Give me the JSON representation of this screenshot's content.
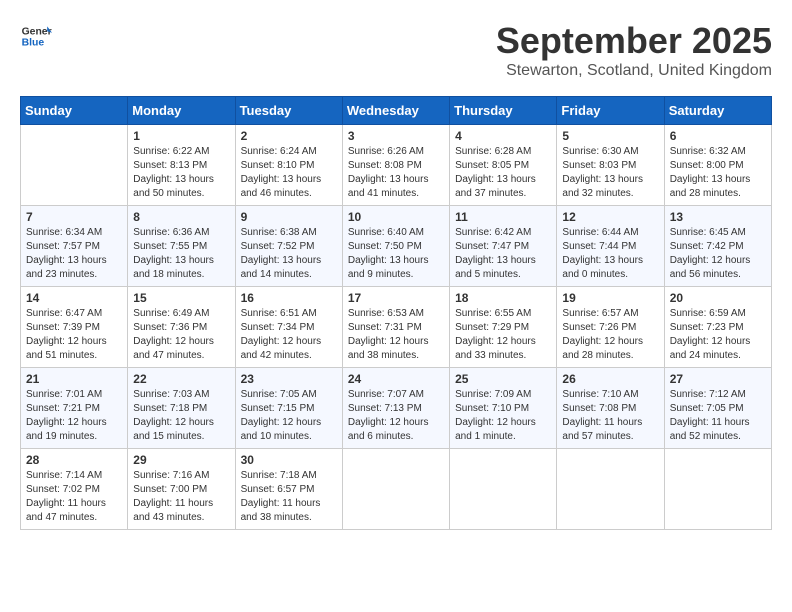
{
  "header": {
    "logo_line1": "General",
    "logo_line2": "Blue",
    "month": "September 2025",
    "location": "Stewarton, Scotland, United Kingdom"
  },
  "weekdays": [
    "Sunday",
    "Monday",
    "Tuesday",
    "Wednesday",
    "Thursday",
    "Friday",
    "Saturday"
  ],
  "weeks": [
    [
      {
        "day": "",
        "sunrise": "",
        "sunset": "",
        "daylight": ""
      },
      {
        "day": "1",
        "sunrise": "Sunrise: 6:22 AM",
        "sunset": "Sunset: 8:13 PM",
        "daylight": "Daylight: 13 hours and 50 minutes."
      },
      {
        "day": "2",
        "sunrise": "Sunrise: 6:24 AM",
        "sunset": "Sunset: 8:10 PM",
        "daylight": "Daylight: 13 hours and 46 minutes."
      },
      {
        "day": "3",
        "sunrise": "Sunrise: 6:26 AM",
        "sunset": "Sunset: 8:08 PM",
        "daylight": "Daylight: 13 hours and 41 minutes."
      },
      {
        "day": "4",
        "sunrise": "Sunrise: 6:28 AM",
        "sunset": "Sunset: 8:05 PM",
        "daylight": "Daylight: 13 hours and 37 minutes."
      },
      {
        "day": "5",
        "sunrise": "Sunrise: 6:30 AM",
        "sunset": "Sunset: 8:03 PM",
        "daylight": "Daylight: 13 hours and 32 minutes."
      },
      {
        "day": "6",
        "sunrise": "Sunrise: 6:32 AM",
        "sunset": "Sunset: 8:00 PM",
        "daylight": "Daylight: 13 hours and 28 minutes."
      }
    ],
    [
      {
        "day": "7",
        "sunrise": "Sunrise: 6:34 AM",
        "sunset": "Sunset: 7:57 PM",
        "daylight": "Daylight: 13 hours and 23 minutes."
      },
      {
        "day": "8",
        "sunrise": "Sunrise: 6:36 AM",
        "sunset": "Sunset: 7:55 PM",
        "daylight": "Daylight: 13 hours and 18 minutes."
      },
      {
        "day": "9",
        "sunrise": "Sunrise: 6:38 AM",
        "sunset": "Sunset: 7:52 PM",
        "daylight": "Daylight: 13 hours and 14 minutes."
      },
      {
        "day": "10",
        "sunrise": "Sunrise: 6:40 AM",
        "sunset": "Sunset: 7:50 PM",
        "daylight": "Daylight: 13 hours and 9 minutes."
      },
      {
        "day": "11",
        "sunrise": "Sunrise: 6:42 AM",
        "sunset": "Sunset: 7:47 PM",
        "daylight": "Daylight: 13 hours and 5 minutes."
      },
      {
        "day": "12",
        "sunrise": "Sunrise: 6:44 AM",
        "sunset": "Sunset: 7:44 PM",
        "daylight": "Daylight: 13 hours and 0 minutes."
      },
      {
        "day": "13",
        "sunrise": "Sunrise: 6:45 AM",
        "sunset": "Sunset: 7:42 PM",
        "daylight": "Daylight: 12 hours and 56 minutes."
      }
    ],
    [
      {
        "day": "14",
        "sunrise": "Sunrise: 6:47 AM",
        "sunset": "Sunset: 7:39 PM",
        "daylight": "Daylight: 12 hours and 51 minutes."
      },
      {
        "day": "15",
        "sunrise": "Sunrise: 6:49 AM",
        "sunset": "Sunset: 7:36 PM",
        "daylight": "Daylight: 12 hours and 47 minutes."
      },
      {
        "day": "16",
        "sunrise": "Sunrise: 6:51 AM",
        "sunset": "Sunset: 7:34 PM",
        "daylight": "Daylight: 12 hours and 42 minutes."
      },
      {
        "day": "17",
        "sunrise": "Sunrise: 6:53 AM",
        "sunset": "Sunset: 7:31 PM",
        "daylight": "Daylight: 12 hours and 38 minutes."
      },
      {
        "day": "18",
        "sunrise": "Sunrise: 6:55 AM",
        "sunset": "Sunset: 7:29 PM",
        "daylight": "Daylight: 12 hours and 33 minutes."
      },
      {
        "day": "19",
        "sunrise": "Sunrise: 6:57 AM",
        "sunset": "Sunset: 7:26 PM",
        "daylight": "Daylight: 12 hours and 28 minutes."
      },
      {
        "day": "20",
        "sunrise": "Sunrise: 6:59 AM",
        "sunset": "Sunset: 7:23 PM",
        "daylight": "Daylight: 12 hours and 24 minutes."
      }
    ],
    [
      {
        "day": "21",
        "sunrise": "Sunrise: 7:01 AM",
        "sunset": "Sunset: 7:21 PM",
        "daylight": "Daylight: 12 hours and 19 minutes."
      },
      {
        "day": "22",
        "sunrise": "Sunrise: 7:03 AM",
        "sunset": "Sunset: 7:18 PM",
        "daylight": "Daylight: 12 hours and 15 minutes."
      },
      {
        "day": "23",
        "sunrise": "Sunrise: 7:05 AM",
        "sunset": "Sunset: 7:15 PM",
        "daylight": "Daylight: 12 hours and 10 minutes."
      },
      {
        "day": "24",
        "sunrise": "Sunrise: 7:07 AM",
        "sunset": "Sunset: 7:13 PM",
        "daylight": "Daylight: 12 hours and 6 minutes."
      },
      {
        "day": "25",
        "sunrise": "Sunrise: 7:09 AM",
        "sunset": "Sunset: 7:10 PM",
        "daylight": "Daylight: 12 hours and 1 minute."
      },
      {
        "day": "26",
        "sunrise": "Sunrise: 7:10 AM",
        "sunset": "Sunset: 7:08 PM",
        "daylight": "Daylight: 11 hours and 57 minutes."
      },
      {
        "day": "27",
        "sunrise": "Sunrise: 7:12 AM",
        "sunset": "Sunset: 7:05 PM",
        "daylight": "Daylight: 11 hours and 52 minutes."
      }
    ],
    [
      {
        "day": "28",
        "sunrise": "Sunrise: 7:14 AM",
        "sunset": "Sunset: 7:02 PM",
        "daylight": "Daylight: 11 hours and 47 minutes."
      },
      {
        "day": "29",
        "sunrise": "Sunrise: 7:16 AM",
        "sunset": "Sunset: 7:00 PM",
        "daylight": "Daylight: 11 hours and 43 minutes."
      },
      {
        "day": "30",
        "sunrise": "Sunrise: 7:18 AM",
        "sunset": "Sunset: 6:57 PM",
        "daylight": "Daylight: 11 hours and 38 minutes."
      },
      {
        "day": "",
        "sunrise": "",
        "sunset": "",
        "daylight": ""
      },
      {
        "day": "",
        "sunrise": "",
        "sunset": "",
        "daylight": ""
      },
      {
        "day": "",
        "sunrise": "",
        "sunset": "",
        "daylight": ""
      },
      {
        "day": "",
        "sunrise": "",
        "sunset": "",
        "daylight": ""
      }
    ]
  ]
}
